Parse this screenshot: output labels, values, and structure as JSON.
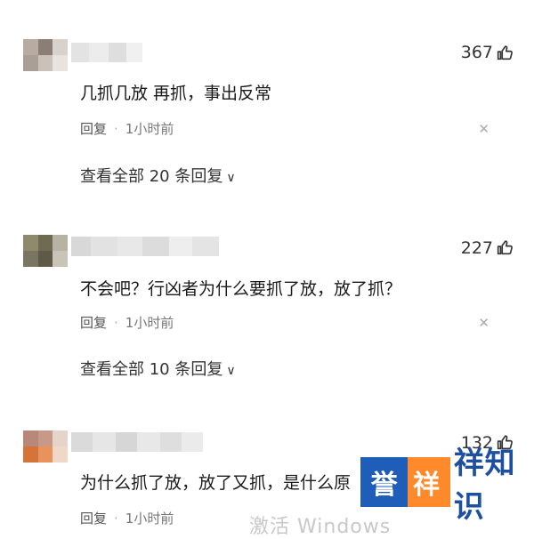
{
  "comments": [
    {
      "likes": "367",
      "text": "几抓几放 再抓，事出反常",
      "reply": "回复",
      "time": "1小时前",
      "expand": "查看全部 20 条回复"
    },
    {
      "likes": "227",
      "text": "不会吧？行凶者为什么要抓了放，放了抓？",
      "reply": "回复",
      "time": "1小时前",
      "expand": "查看全部 10 条回复"
    },
    {
      "likes": "132",
      "text": "为什么抓了放，放了又抓，是什么原",
      "reply": "回复",
      "time": "1小时前"
    }
  ],
  "watermark": "激活 Windows",
  "logo": {
    "char1": "誉",
    "char2": "祥",
    "rest": "祥知识"
  },
  "icons": {
    "like": "thumbs-up-icon",
    "close": "close-icon",
    "expand": "chevron-down-icon"
  }
}
